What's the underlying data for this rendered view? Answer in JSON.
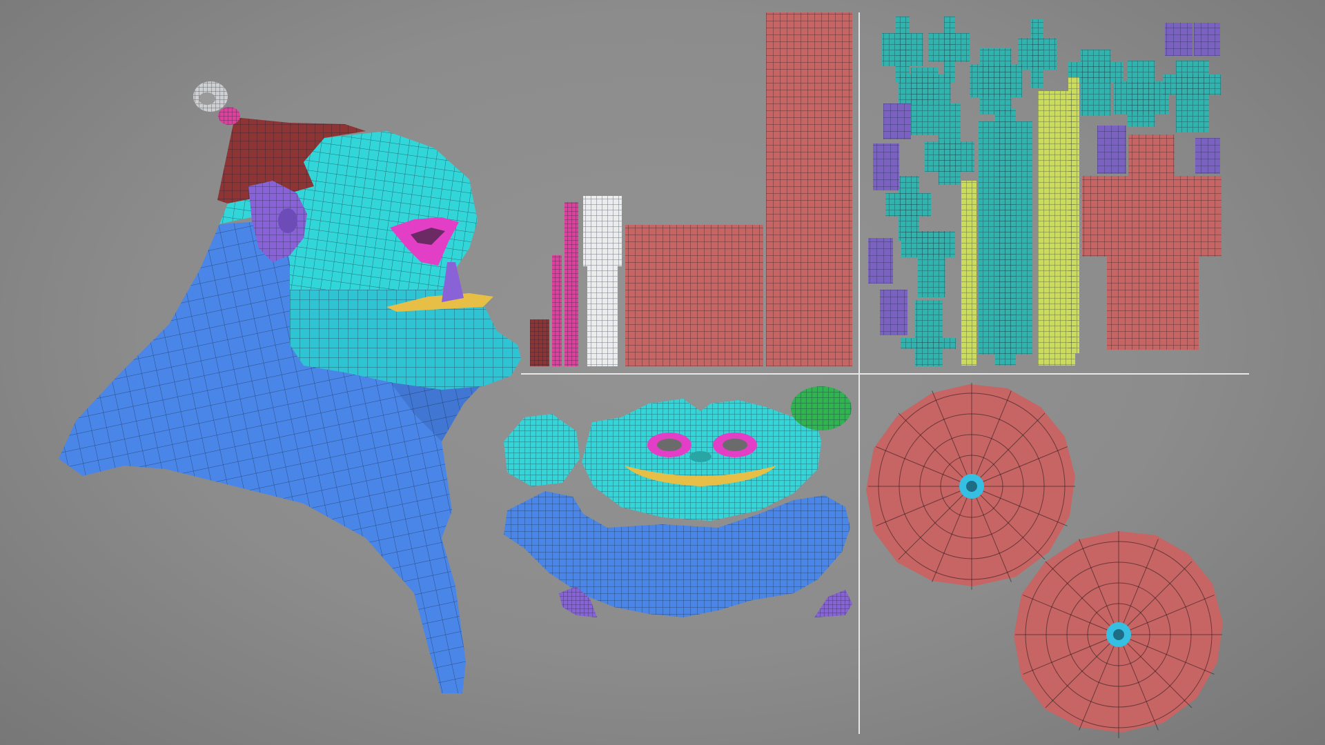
{
  "scene": {
    "background_color": "#8c8c8c",
    "divider_color": "#e8e8e8"
  },
  "uv_shell_colors": {
    "head_blue": "#4a86e8",
    "face_cyan": "#33d6d8",
    "cap_red": "#8e3434",
    "ear_purple": "#8a62d8",
    "eye_magenta": "#e23fc6",
    "lip_yellow": "#e7be46",
    "brick_red": "#c76464",
    "knot_gray": "#cfcfcf",
    "strap_pink": "#e0409b",
    "strap_white": "#ececec",
    "teal": "#2fb3ad",
    "lime": "#cddc58",
    "violet": "#7b62c2",
    "green": "#2fb44f",
    "disc_cyan": "#35bfe2"
  }
}
